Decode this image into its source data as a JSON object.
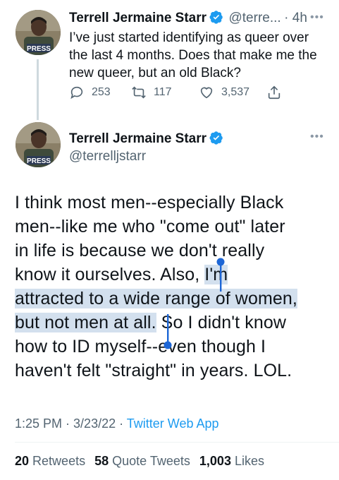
{
  "tweet1": {
    "name": "Terrell Jermaine Starr",
    "handle": "@terre...",
    "time": "4h",
    "avatar_badge": "PRESS",
    "text_lines": [
      "I’ve just started identifying as queer over",
      "the last 4 months. Does that make me the",
      "new queer, but an old Black?"
    ],
    "replies": "253",
    "retweets": "117",
    "likes": "3,537"
  },
  "tweet2": {
    "name": "Terrell Jermaine Starr",
    "handle": "@terrelljstarr",
    "avatar_badge": "PRESS",
    "lines": [
      {
        "pre": "I think most men--especially Black",
        "hl": "",
        "post": ""
      },
      {
        "pre": "men--like me who \"come out\" later",
        "hl": "",
        "post": ""
      },
      {
        "pre": "in life is because we don't really",
        "hl": "",
        "post": ""
      },
      {
        "pre": "know it ourselves. Also, ",
        "hl": "I'm",
        "post": ""
      },
      {
        "pre": "",
        "hl": "attracted to a wide range of women,",
        "post": ""
      },
      {
        "pre": "",
        "hl": "but not men at all.",
        "post": " So I didn't know"
      },
      {
        "pre": "how to ID myself--even though I",
        "hl": "",
        "post": ""
      },
      {
        "pre": "haven't felt \"straight\" in years. LOL.",
        "hl": "",
        "post": ""
      }
    ],
    "time": "1:25 PM",
    "date": "3/23/22",
    "app": "Twitter Web App",
    "retweets_count": "20",
    "retweets_label": "Retweets",
    "quotes_count": "58",
    "quotes_label": "Quote Tweets",
    "likes_count": "1,003",
    "likes_label": "Likes"
  },
  "colors": {
    "accent": "#1d9bf0",
    "selection": "#d3e0ee",
    "muted": "#536471"
  }
}
